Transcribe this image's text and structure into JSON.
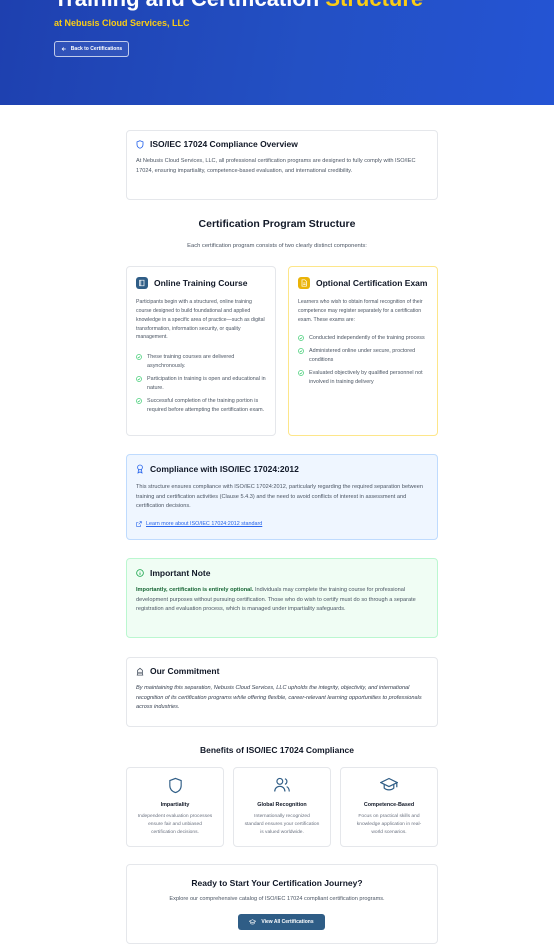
{
  "hero": {
    "title_main": "Training and Certification ",
    "title_accent": "Structure",
    "subtitle": "at Nebusis Cloud Services, LLC",
    "back_label": "Back to Certifications",
    "accent_color": "#facc15"
  },
  "overview": {
    "icon": "shield-icon",
    "title": "ISO/IEC 17024 Compliance Overview",
    "body": "At Nebusis Cloud Services, LLC, all professional certification programs are designed to fully comply with ISO/IEC 17024, ensuring impartiality, competence-based evaluation, and international credibility."
  },
  "structure": {
    "title": "Certification Program Structure",
    "intro": "Each certification program consists of two clearly distinct components:"
  },
  "training": {
    "icon": "book-icon",
    "title": "Online Training Course",
    "body": "Participants begin with a structured, online training course designed to build foundational and applied knowledge in a specific area of practice—such as digital transformation, information security, or quality management.",
    "items": [
      "These training courses are delivered asynchronously.",
      "Participation in training is open and educational in nature.",
      "Successful completion of the training portion is required before attempting the certification exam."
    ]
  },
  "exam": {
    "icon": "document-icon",
    "title": "Optional Certification Exam",
    "body": "Learners who wish to obtain formal recognition of their competence may register separately for a certification exam. These exams are:",
    "items": [
      "Conducted independently of the training process",
      "Administered online under secure, proctored conditions",
      "Evaluated objectively by qualified personnel not involved in training delivery"
    ]
  },
  "compliance": {
    "icon": "award-icon",
    "title": "Compliance with ISO/IEC 17024:2012",
    "body": "This structure ensures compliance with ISO/IEC 17024:2012, particularly regarding the required separation between training and certification activities (Clause 5.4.3) and the need to avoid conflicts of interest in assessment and certification decisions.",
    "link_label": "Learn more about ISO/IEC 17024:2012 standard"
  },
  "note": {
    "icon": "info-icon",
    "title": "Important Note",
    "bold": "Importantly, certification is entirely optional.",
    "body": " Individuals may complete the training course for professional development purposes without pursuing certification. Those who do wish to certify must do so through a separate registration and evaluation process, which is managed under impartiality safeguards."
  },
  "commitment": {
    "icon": "building-icon",
    "title": "Our Commitment",
    "body": "By maintaining this separation, Nebusis Cloud Services, LLC upholds the integrity, objectivity, and international recognition of its certification programs while offering flexible, career-relevant learning opportunities to professionals across industries."
  },
  "benefits": {
    "title": "Benefits of ISO/IEC 17024 Compliance",
    "items": [
      {
        "icon": "shield-icon",
        "title": "Impartiality",
        "desc": "Independent evaluation processes ensure fair and unbiased certification decisions."
      },
      {
        "icon": "users-icon",
        "title": "Global Recognition",
        "desc": "Internationally recognized standard ensures your certification is valued worldwide."
      },
      {
        "icon": "graduation-cap-icon",
        "title": "Competence-Based",
        "desc": "Focus on practical skills and knowledge application in real-world scenarios."
      }
    ]
  },
  "cta": {
    "title": "Ready to Start Your Certification Journey?",
    "body": "Explore our comprehensive catalog of ISO/IEC 17024 compliant certification programs.",
    "button_label": "View All Certifications"
  }
}
